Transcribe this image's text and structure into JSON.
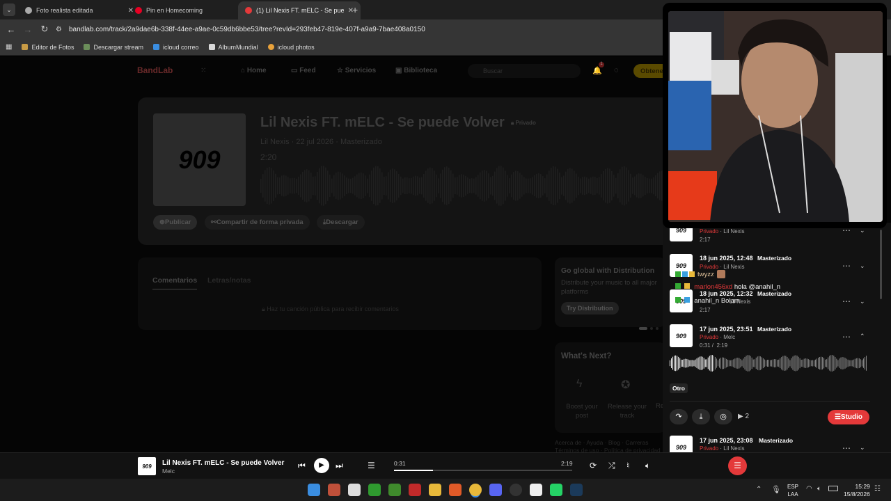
{
  "browser": {
    "tabs": [
      {
        "title": "Foto realista editada",
        "color": "#aaaaaa",
        "active": false
      },
      {
        "title": "Pin en Homecoming",
        "color": "#e60023",
        "active": false
      },
      {
        "title": "(1) Lil Nexis FT. mELC - Se pued",
        "color": "#e4393a",
        "active": true
      }
    ],
    "url": "bandlab.com/track/2a9dae6b-338f-44ee-a9ae-0c59db6bbe53/tree?revId=293feb47-819e-407f-a9a9-7bae408a0150",
    "bookmarks": [
      "Editor de Fotos",
      "Descargar stream",
      "icloud correo",
      "AlbumMundial",
      "icloud photos"
    ]
  },
  "bandlab": {
    "logo": "BandLab",
    "nav": [
      "Home",
      "Feed",
      "Servicios",
      "Biblioteca"
    ],
    "search_placeholder": "Buscar",
    "cta": "Obtene",
    "notif_count": "1",
    "track": {
      "title": "Lil Nexis FT. mELC - Se puede Volver",
      "privacy": "Privado",
      "meta": "Lil Nexis · 22 jul 2026 · Masterizado",
      "duration": "2:20",
      "cover_text": "909"
    },
    "actions": [
      "Publicar",
      "Compartir de forma privada",
      "Descargar"
    ],
    "tabs": [
      "Comentarios",
      "Letras/notas"
    ],
    "comments_hint": "Haz tu canción pública para recibir comentarios",
    "promo": {
      "title": "Go global with Distribution",
      "text": "Distribute your music to all major platforms",
      "button": "Try Distribution"
    },
    "whats_next": {
      "title": "What's Next?",
      "items": [
        "Boost your post",
        "Release your track",
        "Re"
      ]
    },
    "footer": "Acerca de · Ayuda · Blog · Carreras",
    "footer2": "Términos de uso · Política de privacidad"
  },
  "versions": [
    {
      "date": "",
      "tag": "",
      "status": "Privado",
      "artist": "Lil Nexis",
      "time": "2:17"
    },
    {
      "date": "18 jun 2025, 12:48",
      "tag": "Masterizado",
      "status": "Privado",
      "artist": "Lil Nexis",
      "time": ""
    },
    {
      "date": "18 jun 2025, 12:32",
      "tag": "Masterizado",
      "status": "Privado",
      "artist": "Lil Nexis",
      "time": "2:17"
    },
    {
      "date": "17 jun 2025, 23:51",
      "tag": "Masterizado",
      "status": "Privado",
      "artist": "Melc",
      "time": "0:31 /  2:19"
    },
    {
      "date": "17 jun 2025, 23:08",
      "tag": "Masterizado",
      "status": "Privado",
      "artist": "Lil Nexis",
      "time": ""
    }
  ],
  "chat": [
    {
      "user": "twyzz",
      "text": "",
      "color": "#e8c9a0"
    },
    {
      "user": "marlon456xd",
      "text": "hola @anahil_n",
      "color": "#e4393a"
    },
    {
      "user": "anahil_n",
      "text": "Bolam",
      "color": "#e8e8e8"
    }
  ],
  "panel": {
    "chip": "Otro",
    "play_count": "2",
    "studio": "Studio",
    "progress": 0.22
  },
  "player": {
    "title": "Lil Nexis FT. mELC - Se puede Volver",
    "artist": "Melc",
    "thumb": "909",
    "current": "0:31",
    "total": "2:19",
    "progress": 0.22
  },
  "taskbar": {
    "lang": "ESP",
    "lang2": "LAA",
    "time": "15:29",
    "date": "15/8/2026"
  },
  "colors": {
    "accent": "#e4393a",
    "cta": "#f5b800"
  }
}
